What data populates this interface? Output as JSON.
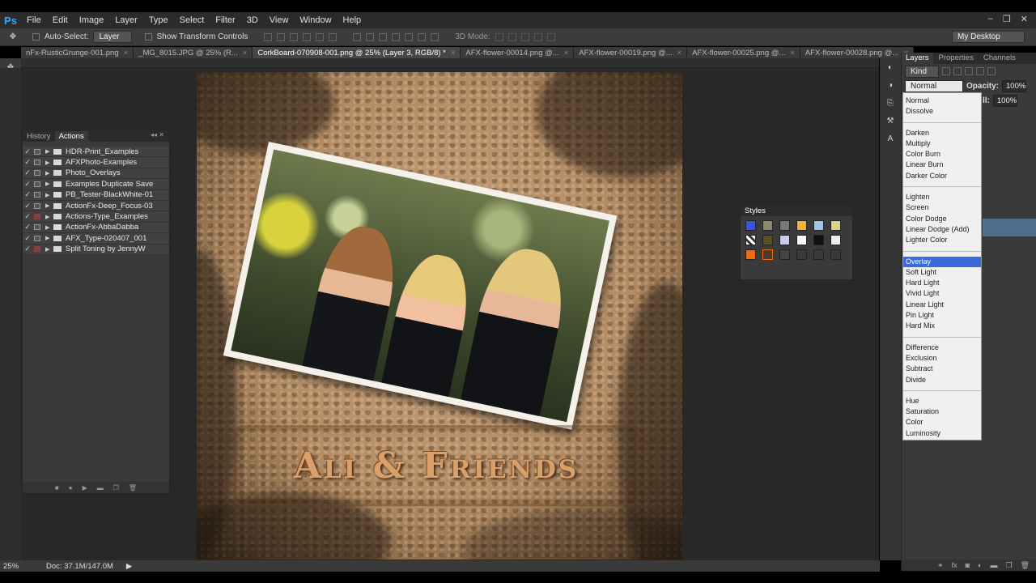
{
  "app": {
    "logo": "Ps"
  },
  "menubar": {
    "items": [
      "File",
      "Edit",
      "Image",
      "Layer",
      "Type",
      "Select",
      "Filter",
      "3D",
      "View",
      "Window",
      "Help"
    ]
  },
  "window_controls": {
    "minimize": "–",
    "restore": "❐",
    "close": "✕"
  },
  "options": {
    "auto_select_label": "Auto-Select:",
    "auto_select_value": "Layer",
    "show_transform_label": "Show Transform Controls",
    "mode_3d_label": "3D Mode:",
    "workspace_value": "My Desktop"
  },
  "tabs": [
    {
      "label": "nFx-RusticGrunge-001.png",
      "close": "×"
    },
    {
      "label": "_MG_8015.JPG @ 25% (R...",
      "close": "×"
    },
    {
      "label": "CorkBoard-070908-001.png @ 25% (Layer 3, RGB/8) *",
      "close": "×"
    },
    {
      "label": "AFX-flower-00014.png @...",
      "close": "×"
    },
    {
      "label": "AFX-flower-00019.png @...",
      "close": "×"
    },
    {
      "label": "AFX-flower-00025.png @...",
      "close": "×"
    },
    {
      "label": "AFX-flower-00028.png @...",
      "close": "×"
    }
  ],
  "canvas": {
    "title_text": "Ali & Friends"
  },
  "actions_panel": {
    "tabs": [
      "History",
      "Actions"
    ],
    "grip": "◂◂ ✕",
    "items": [
      {
        "label": "HDR-Print_Examples",
        "red": false
      },
      {
        "label": "AFXPhoto-Examples",
        "red": false
      },
      {
        "label": "Photo_Overlays",
        "red": false
      },
      {
        "label": "Examples Duplicate Save",
        "red": false
      },
      {
        "label": "PB_Tester-BlackWhite-01",
        "red": false
      },
      {
        "label": "ActionFx-Deep_Focus-03",
        "red": false
      },
      {
        "label": "Actions-Type_Examples",
        "red": true
      },
      {
        "label": "ActionFx-AbbaDabba",
        "red": false
      },
      {
        "label": "AFX_Type-020407_001",
        "red": false
      },
      {
        "label": "Split Toning by JennyW",
        "red": true
      }
    ]
  },
  "styles_panel": {
    "title": "Styles"
  },
  "layers_panel": {
    "tabs": [
      "Layers",
      "Properties",
      "Channels"
    ],
    "kind_label": "Kind",
    "blend_value": "Normal",
    "opacity_label": "Opacity:",
    "opacity_value": "100%",
    "fill_label": "ll:",
    "fill_value": "100%"
  },
  "blend_menu": {
    "groups": [
      [
        "Normal",
        "Dissolve"
      ],
      [
        "Darken",
        "Multiply",
        "Color Burn",
        "Linear Burn",
        "Darker Color"
      ],
      [
        "Lighten",
        "Screen",
        "Color Dodge",
        "Linear Dodge (Add)",
        "Lighter Color"
      ],
      [
        "Overlay",
        "Soft Light",
        "Hard Light",
        "Vivid Light",
        "Linear Light",
        "Pin Light",
        "Hard Mix"
      ],
      [
        "Difference",
        "Exclusion",
        "Subtract",
        "Divide"
      ],
      [
        "Hue",
        "Saturation",
        "Color",
        "Luminosity"
      ]
    ],
    "selected": "Overlay"
  },
  "statusbar": {
    "zoom": "25%",
    "doc_info": "Doc: 37.1M/147.0M"
  },
  "colors": {
    "accent": "#3a6bd9",
    "ps_blue": "#31a8ff",
    "chrome": "#3a3a3a"
  }
}
